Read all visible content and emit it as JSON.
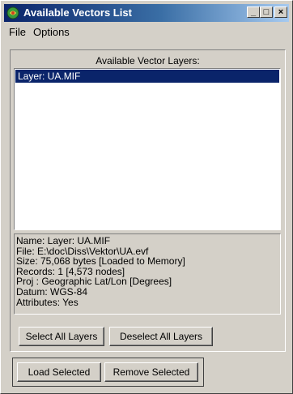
{
  "window": {
    "title": "Available Vectors List"
  },
  "titlebar_buttons": {
    "minimize": "_",
    "maximize": "□",
    "close": "×"
  },
  "menu": {
    "file": "File",
    "options": "Options"
  },
  "layers": {
    "caption": "Available Vector Layers:",
    "items": [
      {
        "label": "Layer: UA.MIF",
        "selected": true
      }
    ]
  },
  "info": {
    "name": "Name: Layer: UA.MIF",
    "file": "File: E:\\doc\\Diss\\Vektor\\UA.evf",
    "size": "Size: 75,068 bytes [Loaded to Memory]",
    "records": "Records: 1 [4,573 nodes]",
    "proj": "Proj : Geographic Lat/Lon [Degrees]",
    "datum": "Datum: WGS-84",
    "attributes": "Attributes: Yes"
  },
  "buttons": {
    "select_all": "Select All Layers",
    "deselect_all": "Deselect All Layers",
    "load_selected": "Load Selected",
    "remove_selected": "Remove Selected"
  },
  "colors": {
    "titlebar_start": "#0a246a",
    "titlebar_end": "#a6caf0",
    "selection": "#0a246a",
    "face": "#d4d0c8"
  },
  "icons": {
    "app": "globe-icon"
  }
}
